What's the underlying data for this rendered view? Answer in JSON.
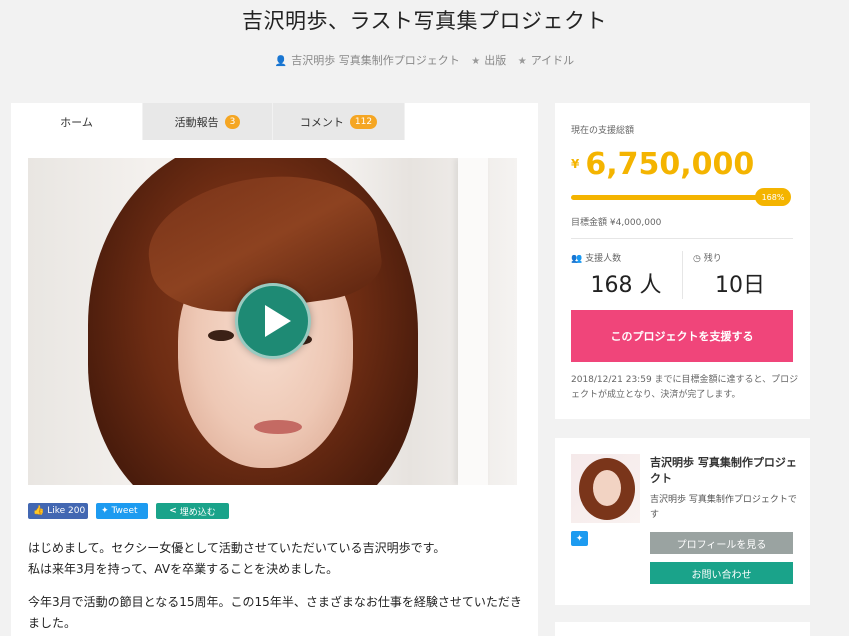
{
  "title": "吉沢明歩、ラスト写真集プロジェクト",
  "meta": {
    "owner": "吉沢明歩 写真集制作プロジェクト",
    "category1": "出版",
    "category2": "アイドル",
    "icons": [
      "user-icon",
      "star-icon",
      "star-icon"
    ]
  },
  "tabs": [
    {
      "label": "ホーム"
    },
    {
      "label": "活動報告",
      "badge": "3"
    },
    {
      "label": "コメント",
      "badge": "112"
    }
  ],
  "social": {
    "like_label": "Like",
    "like_count": "200",
    "tweet_label": "Tweet",
    "embed_label": "埋め込む"
  },
  "body": {
    "p1_line1": "はじめまして。セクシー女優として活動させていただいている吉沢明歩です。",
    "p1_line2": "私は来年3月を持って、AVを卒業することを決めました。",
    "p2": "今年3月で活動の節目となる15周年。この15年半、さまざまなお仕事を経験させていただきました。"
  },
  "funding": {
    "label": "現在の支援総額",
    "currency": "¥",
    "amount": "6,750,000",
    "percent_label": "168%",
    "progress_fraction": 1.0,
    "goal": "目標金額 ¥4,000,000",
    "supporters_label": "支援人数",
    "supporters": "168 人",
    "remaining_label": "残り",
    "remaining": "10日",
    "support_button": "このプロジェクトを支援する",
    "note": "2018/12/21 23:59 までに目標金額に達すると、プロジェクトが成立となり、決済が完了します。"
  },
  "owner": {
    "name": "吉沢明歩 写真集制作プロジェクト",
    "desc": "吉沢明歩 写真集制作プロジェクトです",
    "profile_button": "プロフィールを見る",
    "contact_button": "お問い合わせ"
  },
  "colors": {
    "accent_yellow": "#f4b400",
    "support_pink": "#f0457a",
    "teal": "#1aa38a"
  }
}
